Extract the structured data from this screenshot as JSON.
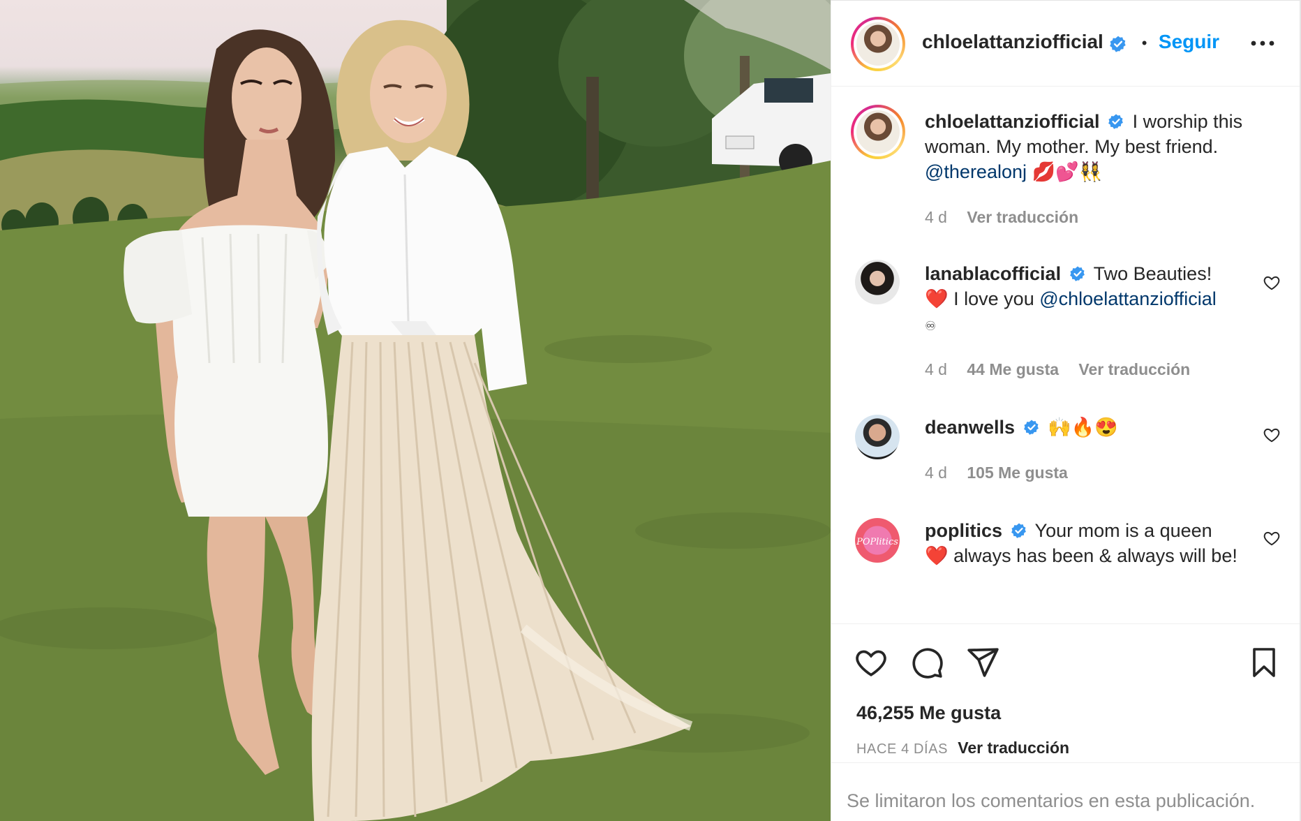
{
  "post": {
    "author": "chloelattanziofficial",
    "follow_label": "Seguir",
    "dot": "•",
    "more_label": "•••",
    "caption": {
      "username": "chloelattanziofficial",
      "text": "I worship this woman. My mother. My best friend.",
      "mention": "@therealonj",
      "emojis": "💋💕👯‍♀️",
      "time": "4 d",
      "translate": "Ver traducción"
    },
    "comments": [
      {
        "username": "lanablacofficial",
        "text_before": "Two Beauties!",
        "emoji": "❤️",
        "text_after": "I love you",
        "mention": "@chloelattanziofficial",
        "trailing": "♾",
        "time": "4 d",
        "likes": "44 Me gusta",
        "translate": "Ver traducción"
      },
      {
        "username": "deanwells",
        "text": "🙌🔥😍",
        "time": "4 d",
        "likes": "105 Me gusta"
      },
      {
        "username": "poplitics",
        "text_before": "Your mom is a queen",
        "emoji": "❤️",
        "text_after": "always has been & always will be!"
      }
    ],
    "likes_count": "46,255 Me gusta",
    "date": "HACE 4 DÍAS",
    "date_translate": "Ver traducción",
    "comments_limited": "Se limitaron los comentarios en esta publicación."
  },
  "colors": {
    "accent": "#0095f6",
    "mention": "#00376b",
    "muted": "#8e8e8e",
    "verified": "#3897f0"
  },
  "icons": [
    "heart-icon",
    "comment-icon",
    "share-icon",
    "bookmark-icon",
    "verified-icon",
    "more-icon"
  ]
}
